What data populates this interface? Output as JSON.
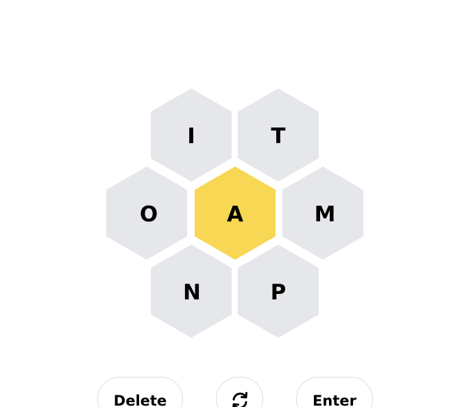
{
  "colors": {
    "outer_cell": "#e6e7eb",
    "center_cell": "#f7d753",
    "letter": "#000000",
    "button_border": "#dcdcdc"
  },
  "hive": {
    "center_letter": "A",
    "outer_letters": {
      "top_left": "I",
      "top_right": "T",
      "left": "O",
      "right": "M",
      "bottom_left": "N",
      "bottom_right": "P"
    }
  },
  "controls": {
    "delete_label": "Delete",
    "shuffle_icon": "shuffle-icon",
    "enter_label": "Enter"
  }
}
